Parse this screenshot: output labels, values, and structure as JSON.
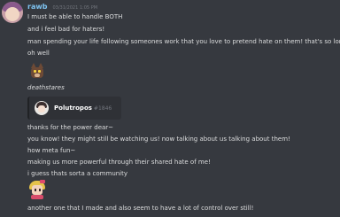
{
  "message": {
    "username": "rawb",
    "timestamp": "03/31/2021 1:05 PM",
    "username_color": "#7ec3f0",
    "lines_top": [
      "I must be able to handle BOTH",
      "and i feel bad for haters!",
      "man spending your life following someones work that you love to pretend hate on them! that's so lonely!",
      "oh well"
    ],
    "sticker_caption": "deathstares",
    "mention": {
      "name": "Polutropos",
      "tag": "#1846"
    },
    "lines_bottom": [
      "thanks for the power dear~",
      "you know! they might still be watching us! now talking about us talking about them!",
      "how meta fun~",
      "making us more powerful through their shared hate of me!",
      "i guess thats sorta a community"
    ],
    "last_line": "another one that I made and also seem to have a lot of control over still!"
  },
  "colors": {
    "background": "#36393f",
    "text": "#dcddde",
    "muted": "#72767d",
    "card": "#2f3136"
  }
}
